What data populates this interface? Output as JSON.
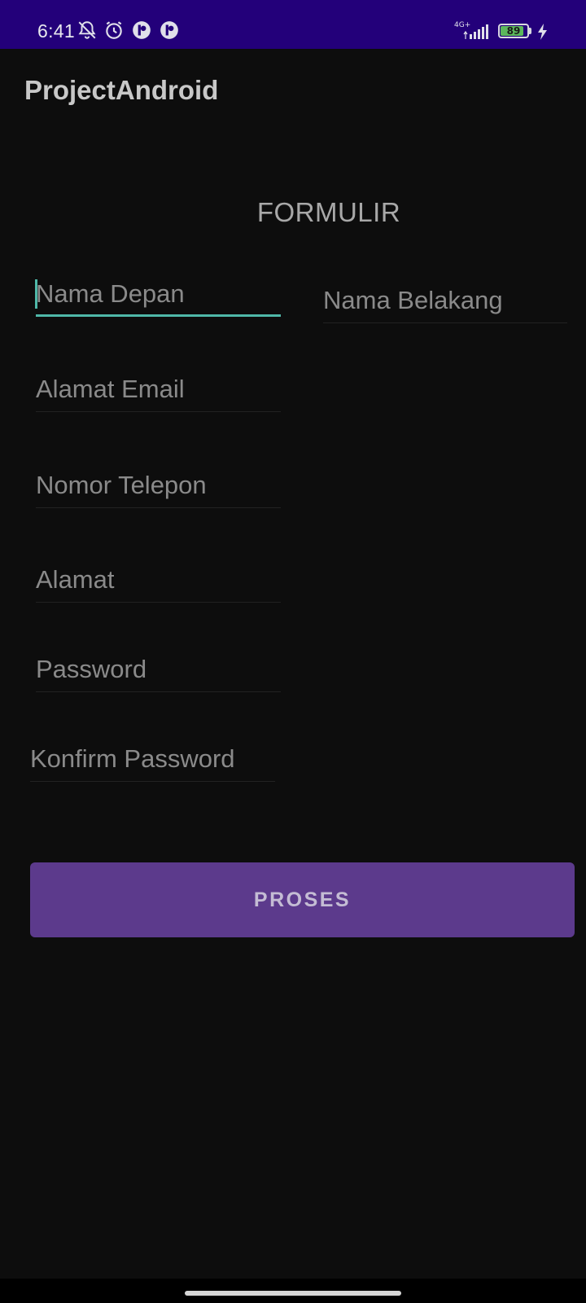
{
  "status_bar": {
    "time": "6:41",
    "icons": [
      "notifications-off-icon",
      "alarm-icon",
      "app-notification-icon",
      "app-notification-icon"
    ],
    "network": "4G+",
    "battery_level": "89",
    "charging": true
  },
  "app_bar": {
    "title": "ProjectAndroid"
  },
  "form": {
    "heading": "FORMULIR",
    "first_name": {
      "placeholder": "Nama Depan",
      "value": ""
    },
    "last_name": {
      "placeholder": "Nama Belakang",
      "value": ""
    },
    "email": {
      "placeholder": "Alamat Email",
      "value": ""
    },
    "phone": {
      "placeholder": "Nomor Telepon",
      "value": ""
    },
    "address": {
      "placeholder": "Alamat",
      "value": ""
    },
    "password": {
      "placeholder": "Password",
      "value": ""
    },
    "confirm_password": {
      "placeholder": "Konfirm Password",
      "value": ""
    },
    "submit_label": "PROSES"
  },
  "colors": {
    "status_bar": "#23007a",
    "background": "#0d0d0d",
    "accent_focus": "#4fb8a8",
    "button": "#5c3a8c"
  }
}
